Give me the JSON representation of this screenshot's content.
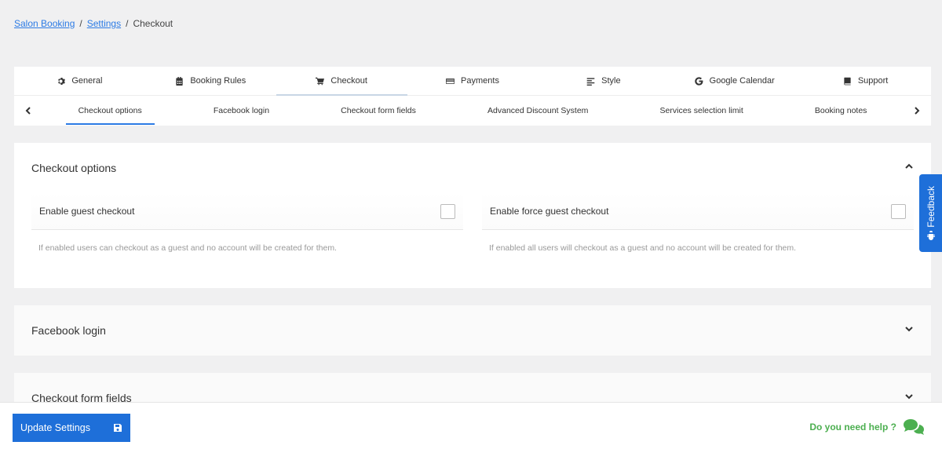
{
  "breadcrumb": {
    "items": [
      "Salon Booking",
      "Settings"
    ],
    "separator": "/",
    "current": "Checkout"
  },
  "main_tabs": [
    {
      "label": "General",
      "icon": "gear-icon"
    },
    {
      "label": "Booking Rules",
      "icon": "calendar-icon"
    },
    {
      "label": "Checkout",
      "icon": "cart-icon",
      "active": true
    },
    {
      "label": "Payments",
      "icon": "credit-card-icon"
    },
    {
      "label": "Style",
      "icon": "align-icon"
    },
    {
      "label": "Google Calendar",
      "icon": "google-icon"
    },
    {
      "label": "Support",
      "icon": "book-icon"
    }
  ],
  "sub_tabs": [
    {
      "label": "Checkout options",
      "active": true
    },
    {
      "label": "Facebook login"
    },
    {
      "label": "Checkout form fields"
    },
    {
      "label": "Advanced Discount System"
    },
    {
      "label": "Services selection limit"
    },
    {
      "label": "Booking notes"
    }
  ],
  "sections": {
    "checkout_options": {
      "title": "Checkout options",
      "options": [
        {
          "label": "Enable guest checkout",
          "help": "If enabled users can checkout as a guest and no account will be created for them.",
          "checked": false
        },
        {
          "label": "Enable force guest checkout",
          "help": "If enabled all users will checkout as a guest and no account will be created for them.",
          "checked": false
        }
      ]
    },
    "facebook_login": {
      "title": "Facebook login"
    },
    "checkout_form_fields": {
      "title": "Checkout form fields"
    }
  },
  "feedback": {
    "label": "Feedback"
  },
  "footer": {
    "update_label": "Update Settings",
    "help_label": "Do you need help ?"
  },
  "colors": {
    "accent": "#1e6fd9",
    "help": "#4caf50",
    "link": "#2c7be5"
  }
}
